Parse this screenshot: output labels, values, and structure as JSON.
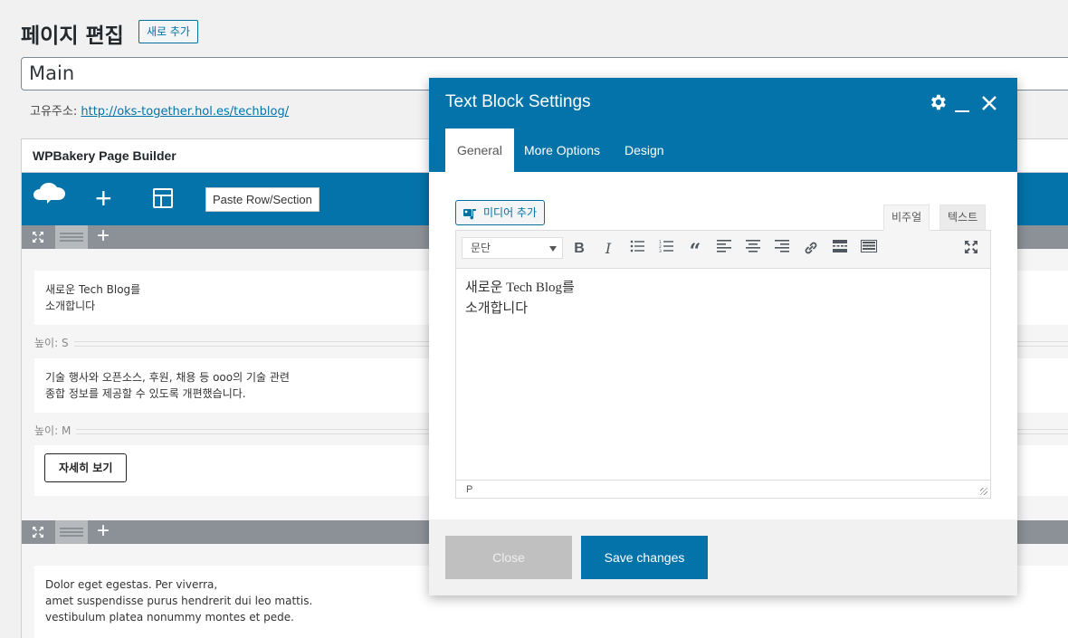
{
  "page": {
    "title": "페이지 편집",
    "add_new_label": "새로 추가",
    "post_title": "Main",
    "permalink_label": "고유주소:",
    "permalink_url": "http://oks-together.hol.es/techblog/"
  },
  "builder": {
    "title": "WPBakery Page Builder",
    "paste_label": "Paste Row/Section",
    "row1": {
      "text_block_lines": [
        "새로운 Tech Blog를",
        "소개합니다"
      ],
      "separator1": "높이: S",
      "text_block2_lines": [
        "기술 행사와 오픈소스, 후원, 채용 등 ooo의 기술 관련",
        "종합 정보를 제공할 수 있도록 개편했습니다."
      ],
      "separator2": "높이: M",
      "button_label": "자세히 보기"
    },
    "row2": {
      "text_lines": [
        "Dolor eget egestas. Per viverra,",
        "amet suspendisse purus hendrerit dui leo mattis.",
        "vestibulum platea nonummy montes et pede."
      ]
    }
  },
  "modal": {
    "title": "Text Block Settings",
    "tabs": [
      "General",
      "More Options",
      "Design"
    ],
    "active_tab": "General",
    "media_label": "미디어 추가",
    "editor_tabs": [
      "비주얼",
      "텍스트"
    ],
    "format_select": "문단",
    "content_lines": [
      "새로운 Tech Blog를",
      "소개합니다"
    ],
    "status_path": "P",
    "close_label": "Close",
    "save_label": "Save changes"
  },
  "colors": {
    "accent": "#0473aa",
    "row_bar": "#8b9196"
  }
}
